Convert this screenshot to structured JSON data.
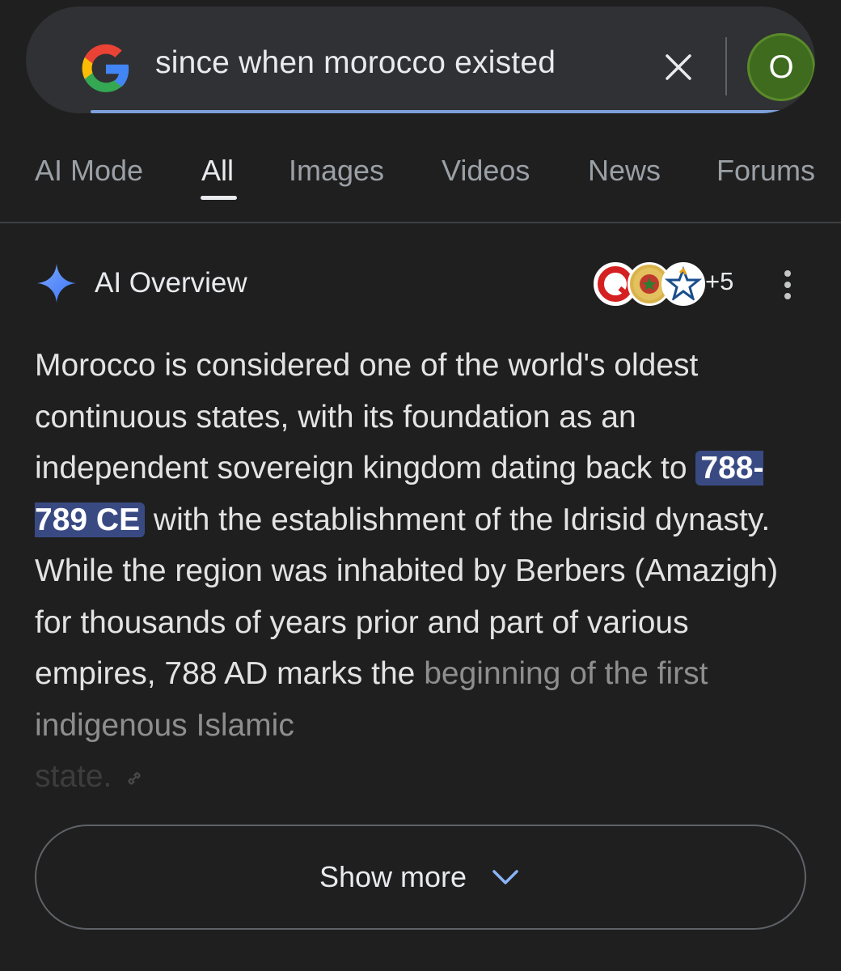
{
  "search": {
    "query": "since when morocco existed",
    "avatar_letter": "O"
  },
  "tabs": [
    {
      "label": "AI Mode"
    },
    {
      "label": "All"
    },
    {
      "label": "Images"
    },
    {
      "label": "Videos"
    },
    {
      "label": "News"
    },
    {
      "label": "Forums"
    }
  ],
  "active_tab": "All",
  "ai_overview": {
    "title": "AI Overview",
    "source_count": "+5",
    "text_before": "Morocco is considered one of the world's oldest continuous states, with its foundation as an independent sovereign kingdom dating back to ",
    "highlight": "788-789 CE",
    "text_after": " with the establishment of the Idrisid dynasty. While the region was inhabited by Berbers (Amazigh) for thousands of years prior and part of various empires, 788 AD marks the ",
    "text_fade": "beginning of the first indigenous Islamic",
    "text_fade2": "state."
  },
  "show_more": {
    "label": "Show more"
  },
  "colors": {
    "background": "#1f1f1f",
    "search_bar": "#303134",
    "highlight_bg": "#394a83",
    "avatar_bg": "#3e6b1e",
    "sparkle": "#4f8df8",
    "underline": "#8ab4f8"
  },
  "icons": [
    "google-g-icon",
    "close-icon",
    "sparkle-icon",
    "more-vert-icon",
    "link-icon",
    "chevron-down-icon"
  ]
}
